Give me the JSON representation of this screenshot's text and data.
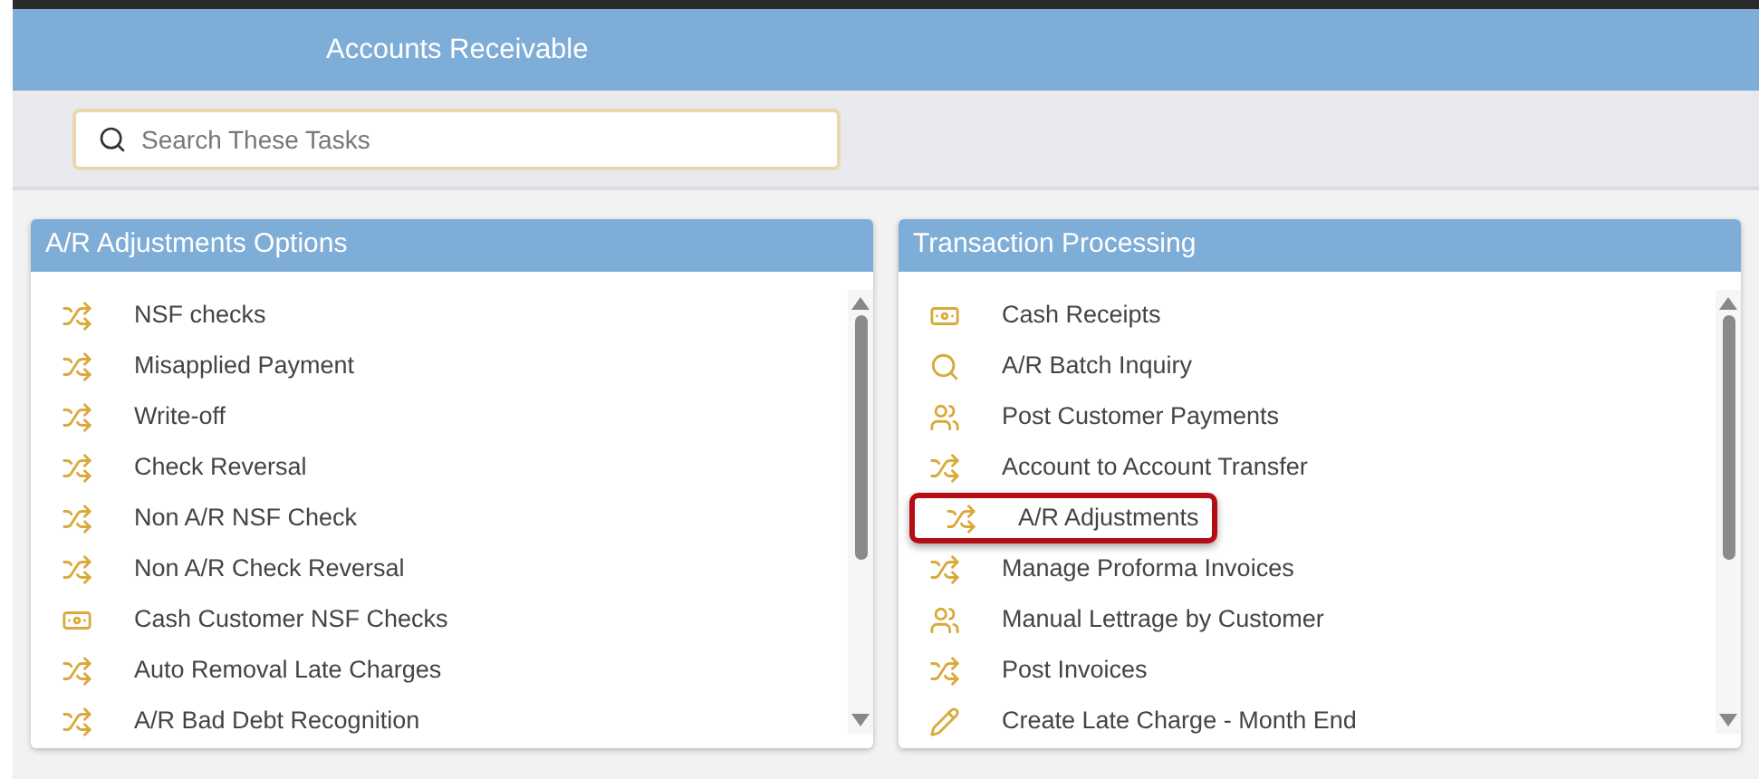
{
  "header": {
    "title": "Accounts Receivable"
  },
  "search": {
    "placeholder": "Search These Tasks"
  },
  "panels": [
    {
      "title": "A/R Adjustments Options",
      "items": [
        {
          "label": "NSF checks",
          "kind": "shuffle",
          "highlighted": false
        },
        {
          "label": "Misapplied Payment",
          "kind": "shuffle",
          "highlighted": false
        },
        {
          "label": "Write-off",
          "kind": "shuffle",
          "highlighted": false
        },
        {
          "label": "Check Reversal",
          "kind": "shuffle",
          "highlighted": false
        },
        {
          "label": "Non A/R NSF Check",
          "kind": "shuffle",
          "highlighted": false
        },
        {
          "label": "Non A/R Check Reversal",
          "kind": "shuffle",
          "highlighted": false
        },
        {
          "label": "Cash Customer NSF Checks",
          "kind": "cash",
          "highlighted": false
        },
        {
          "label": "Auto Removal Late Charges",
          "kind": "shuffle",
          "highlighted": false
        },
        {
          "label": "A/R Bad Debt Recognition",
          "kind": "shuffle",
          "highlighted": false
        }
      ]
    },
    {
      "title": "Transaction Processing",
      "items": [
        {
          "label": "Cash Receipts",
          "kind": "cash",
          "highlighted": false
        },
        {
          "label": "A/R Batch Inquiry",
          "kind": "search",
          "highlighted": false
        },
        {
          "label": "Post Customer Payments",
          "kind": "people",
          "highlighted": false
        },
        {
          "label": "Account to Account Transfer",
          "kind": "shuffle",
          "highlighted": false
        },
        {
          "label": "A/R Adjustments",
          "kind": "shuffle",
          "highlighted": true
        },
        {
          "label": "Manage Proforma Invoices",
          "kind": "shuffle",
          "highlighted": false
        },
        {
          "label": "Manual Lettrage by Customer",
          "kind": "people",
          "highlighted": false
        },
        {
          "label": "Post Invoices",
          "kind": "shuffle",
          "highlighted": false
        },
        {
          "label": "Create Late Charge - Month End",
          "kind": "pencil",
          "highlighted": false
        }
      ]
    }
  ]
}
